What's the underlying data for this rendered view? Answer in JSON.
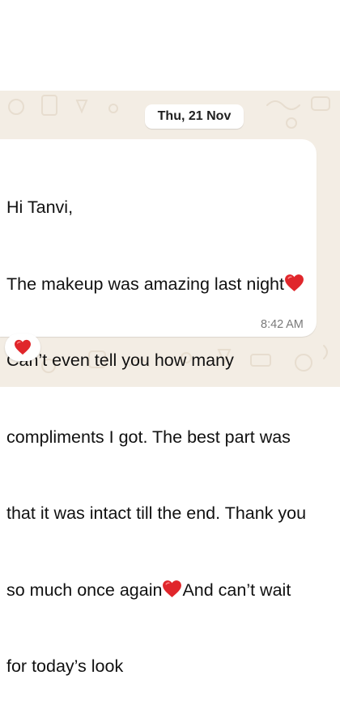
{
  "chat": {
    "date_label": "Thu, 21 Nov",
    "message": {
      "lines": [
        "Hi Tanvi,",
        "The makeup was amazing last night",
        "Can’t even tell you how many",
        "compliments I got. The best part was",
        "that it was intact till the end. Thank you",
        "so much once again",
        "And can’t wait",
        "for today’s look"
      ],
      "time": "8:42 AM"
    },
    "reaction": "red-heart-icon",
    "colors": {
      "wallpaper": "#f3ede4",
      "bubble": "#ffffff",
      "heart": "#e0262b",
      "timestamp": "#7a7a7a"
    }
  }
}
